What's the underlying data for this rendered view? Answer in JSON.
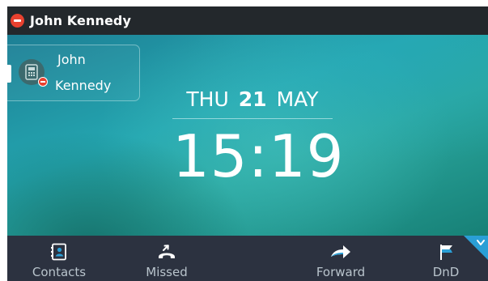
{
  "status_bar": {
    "user_name": "John Kennedy",
    "presence": "do-not-disturb",
    "presence_icon": "presence-dnd-icon",
    "presence_color": "#e8412f"
  },
  "blf_key": {
    "first_name": "John",
    "last_name": "Kennedy",
    "avatar_icon": "desk-phone-icon",
    "status_icon": "presence-dnd-icon",
    "status_color": "#e8412f"
  },
  "datetime": {
    "weekday": "THU",
    "day": "21",
    "month": "MAY",
    "time": "15:19"
  },
  "softkeys": [
    {
      "label": "Contacts",
      "icon": "contacts-icon"
    },
    {
      "label": "Missed",
      "icon": "missed-call-icon"
    },
    {
      "label": "Forward",
      "icon": "forward-icon"
    },
    {
      "label": "DnD",
      "icon": "dnd-flag-icon"
    }
  ],
  "colors": {
    "status_bar_bg": "#23282c",
    "softkey_bar_bg": "#2c3240",
    "accent": "#2a9fd6",
    "softkey_icon": "#ffffff",
    "softkey_label": "#b9c4cc"
  }
}
